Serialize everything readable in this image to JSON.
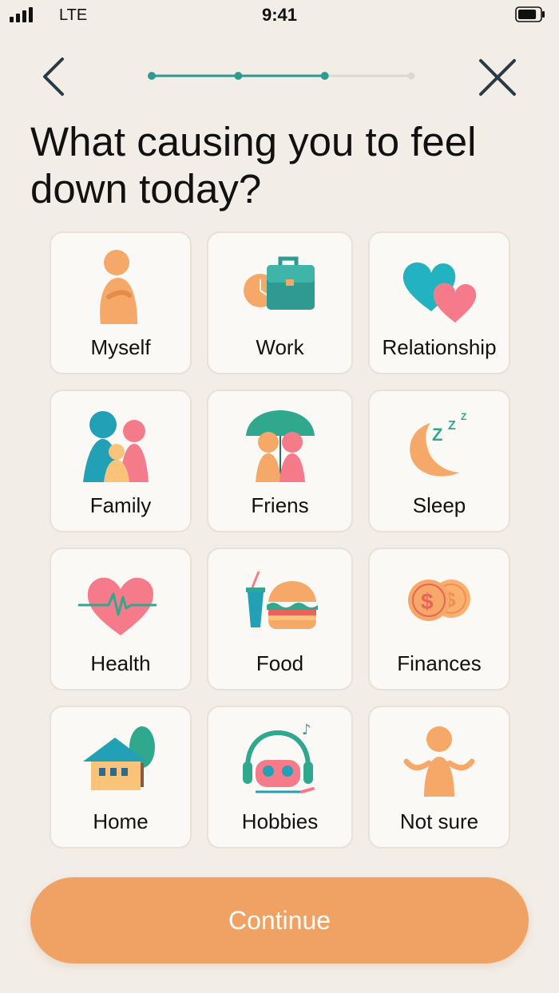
{
  "status_bar": {
    "carrier": "LTE",
    "time": "9:41",
    "signal_bars": 4,
    "battery_level": 0.85
  },
  "nav": {
    "back_icon": "chevron-left-icon",
    "close_icon": "close-icon",
    "progress": {
      "total_steps": 4,
      "current_step": 3
    }
  },
  "title": "What causing you to feel down today?",
  "options": [
    {
      "label": "Myself",
      "icon": "person-icon"
    },
    {
      "label": "Work",
      "icon": "briefcase-clock-icon"
    },
    {
      "label": "Relationship",
      "icon": "hearts-icon"
    },
    {
      "label": "Family",
      "icon": "family-icon"
    },
    {
      "label": "Friens",
      "icon": "friends-umbrella-icon"
    },
    {
      "label": "Sleep",
      "icon": "moon-sleep-icon"
    },
    {
      "label": "Health",
      "icon": "heartbeat-icon"
    },
    {
      "label": "Food",
      "icon": "burger-drink-icon"
    },
    {
      "label": "Finances",
      "icon": "coins-icon"
    },
    {
      "label": "Home",
      "icon": "house-icon"
    },
    {
      "label": "Hobbies",
      "icon": "headphones-gamepad-icon"
    },
    {
      "label": "Not sure",
      "icon": "shrug-icon"
    }
  ],
  "continue_label": "Continue",
  "colors": {
    "background": "#f2ede7",
    "tile": "#fbf9f5",
    "accent_teal": "#2f9a8f",
    "accent_orange": "#f0a264",
    "accent_pink": "#f47f86"
  }
}
